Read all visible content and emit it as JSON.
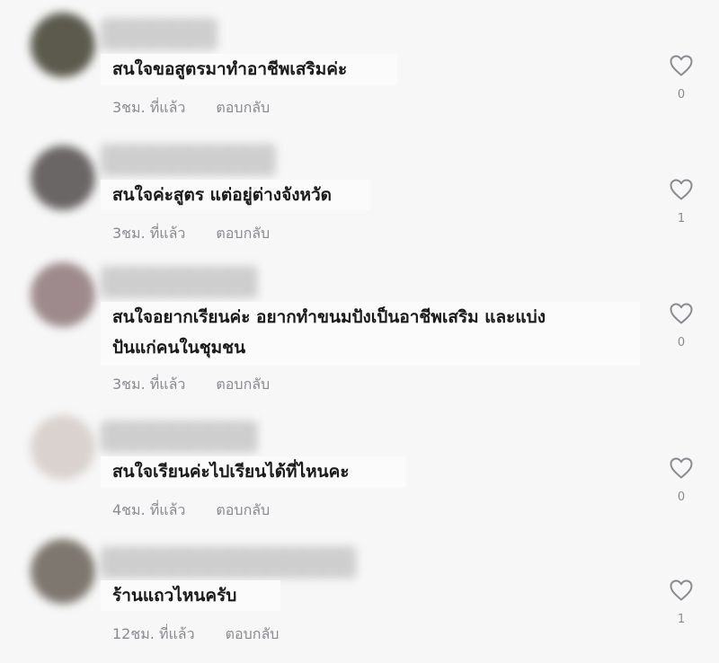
{
  "comments": [
    {
      "text": "สนใจขอสูตรมาทำอาชีพเสริมค่ะ",
      "time": "3ชม. ที่แล้ว",
      "reply": "ตอบกลับ",
      "likes": "0",
      "avatar_color": "#5b5a4d",
      "heart_icon": "heart-outline-icon"
    },
    {
      "text": "สนใจค่ะสูตร แต่อยู่ต่างจังหวัด",
      "time": "3ชม. ที่แล้ว",
      "reply": "ตอบกลับ",
      "likes": "1",
      "avatar_color": "#6b6666",
      "heart_icon": "heart-outline-icon"
    },
    {
      "text": "สนใจอยากเรียนค่ะ อยากทำขนมปังเป็นอาชีพเสริม และแบ่ง\nปันแก่คนในชุมชน",
      "time": "3ชม. ที่แล้ว",
      "reply": "ตอบกลับ",
      "likes": "0",
      "avatar_color": "#9e8a8c",
      "heart_icon": "heart-outline-icon"
    },
    {
      "text": "สนใจเรียนค่ะไปเรียนได้ที่ไหนคะ",
      "time": "4ชม. ที่แล้ว",
      "reply": "ตอบกลับ",
      "likes": "0",
      "avatar_color": "#d9d2cf",
      "heart_icon": "heart-outline-icon"
    },
    {
      "text": "ร้านแถวไหนครับ",
      "time": "12ชม. ที่แล้ว",
      "reply": "ตอบกลับ",
      "likes": "1",
      "avatar_color": "#7d776f",
      "heart_icon": "heart-outline-icon"
    }
  ]
}
